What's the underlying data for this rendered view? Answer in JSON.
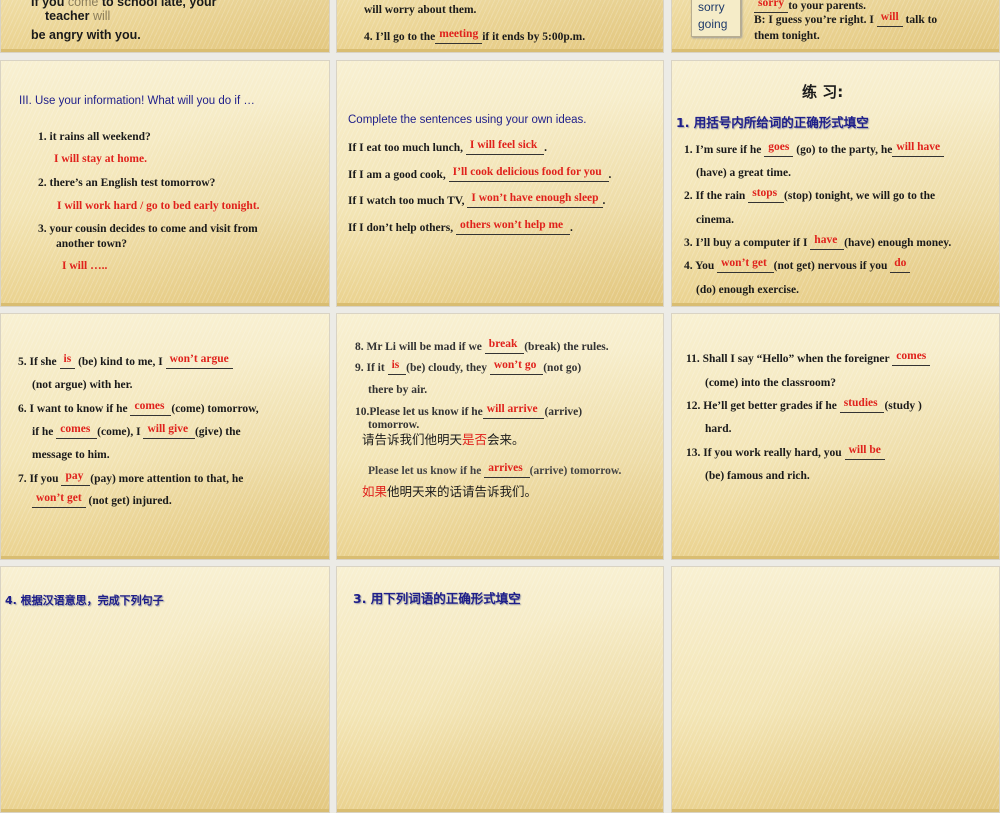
{
  "slides": {
    "r1c1": {
      "lines": [
        [
          "If you ",
          {
            "g": "come"
          },
          " to school late, your"
        ],
        [
          "teacher ",
          {
            "g": "will"
          }
        ],
        [
          "be angry with you."
        ]
      ]
    },
    "r1c2": {
      "lines": [
        [
          "will worry about them."
        ],
        [
          "4. I’ll go to the",
          {
            "a": "meeting"
          },
          "if it ends by 5:00p.m."
        ]
      ]
    },
    "r1c3": {
      "word_box": [
        "sorry",
        "going"
      ],
      "lines": [
        [
          {
            "a": "sorry"
          },
          "to your parents."
        ],
        [
          "B: I guess you’re right. I ",
          {
            "a": "will"
          },
          " talk to"
        ],
        [
          "them tonight."
        ]
      ]
    },
    "r2c1": {
      "title": "III. Use your information! What will you do if …",
      "lines": [
        [
          "1.   it rains all weekend?"
        ],
        [
          {
            "r": "I will stay at home."
          }
        ],
        [
          "2. there’s an English test tomorrow?"
        ],
        [
          {
            "r": "I will work hard / go to bed early tonight."
          }
        ],
        [
          "3. your cousin decides to come and visit from"
        ],
        [
          "another town?"
        ],
        [
          {
            "r": "I will ….."
          }
        ]
      ]
    },
    "r2c2": {
      "title": "Complete the sentences using your own ideas.",
      "lines": [
        [
          "If I eat too much lunch, ",
          {
            "a": "I will feel sick    "
          },
          "."
        ],
        [
          "If I am a good cook, ",
          {
            "a": "   I’ll cook delicious food for you   "
          },
          "."
        ],
        [
          "If I watch too much TV, ",
          {
            "a": "I won’t have enough sleep"
          },
          "."
        ],
        [
          "If I don’t help others, ",
          {
            "a": "  others won’t help me        "
          },
          "."
        ]
      ]
    },
    "r2c3": {
      "title": "练  习:",
      "subtitle": "1. 用括号内所给词的正确形式填空",
      "lines": [
        [
          "1. I’m sure if he ",
          {
            "a": "goes"
          },
          " (go) to the party, he",
          {
            "a": "will  have "
          }
        ],
        [
          "(have) a great time."
        ],
        [
          "2. If the rain ",
          {
            "a": " stops "
          },
          "(stop) tonight, we will go to the"
        ],
        [
          "cinema."
        ],
        [
          "3. I’ll buy a computer if I ",
          {
            "a": " have "
          },
          "(have) enough money."
        ],
        [
          "4. You ",
          {
            "a": " won’t get "
          },
          " (not get) nervous if you ",
          {
            "a": "do  "
          }
        ],
        [
          "(do) enough exercise."
        ]
      ]
    },
    "r3c1": {
      "lines": [
        [
          "5. If she ",
          {
            "a": "is"
          },
          " (be) kind to me, I ",
          {
            "a": "won’t argue"
          }
        ],
        [
          "(not argue) with her."
        ],
        [
          "6. I want to know if he ",
          {
            "a": "comes "
          },
          "(come) tomorrow,"
        ],
        [
          "if he ",
          {
            "a": "comes "
          },
          "(come), I ",
          {
            "a": "will  give "
          },
          "(give) the"
        ],
        [
          "message to him."
        ],
        [
          "7. If you ",
          {
            "a": " pay "
          },
          " (pay) more attention to that, he"
        ],
        [
          {
            "a": "won’t get"
          },
          " (not get) injured."
        ]
      ]
    },
    "r3c2": {
      "lines": [
        [
          "8. Mr Li will be mad if we ",
          {
            "a": "break  "
          },
          "(break) the rules."
        ],
        [
          "9. If it ",
          {
            "a": "is  "
          },
          " (be) cloudy, they ",
          {
            "a": "won’t  go   "
          },
          "(not go)"
        ],
        [
          "there by air."
        ],
        [
          "10.Please let us know if he",
          {
            "a": "will arrive "
          },
          " (arrive)"
        ],
        [
          "tomorrow."
        ],
        [
          {
            "c": "请告诉我们他明天"
          },
          {
            "cr": "是否"
          },
          {
            "c": "会来。"
          }
        ],
        [
          "Please let us know if he ",
          {
            "a": " arrives   "
          },
          " (arrive) tomorrow."
        ],
        [
          {
            "cr": "如果"
          },
          {
            "c": "他明天来的话请告诉我们。"
          }
        ]
      ]
    },
    "r3c3": {
      "lines": [
        [
          "11. Shall I say “Hello” when the foreigner ",
          {
            "a": "comes "
          }
        ],
        [
          "(come) into the classroom?"
        ],
        [
          "12. He’ll get better grades if he ",
          {
            "a": "studies "
          },
          " (study )"
        ],
        [
          "hard."
        ],
        [
          "13. If you work really hard, you ",
          {
            "a": "will  be  "
          }
        ],
        [
          "(be) famous and rich."
        ]
      ]
    },
    "r4c1": {
      "title": "4. 根据汉语意思，完成下列句子"
    },
    "r4c2": {
      "title": "3. 用下列词语的正确形式填空"
    }
  },
  "colors": {
    "answer": "#e0221c",
    "title": "#1e1e8a",
    "background": "#ecebe6"
  }
}
